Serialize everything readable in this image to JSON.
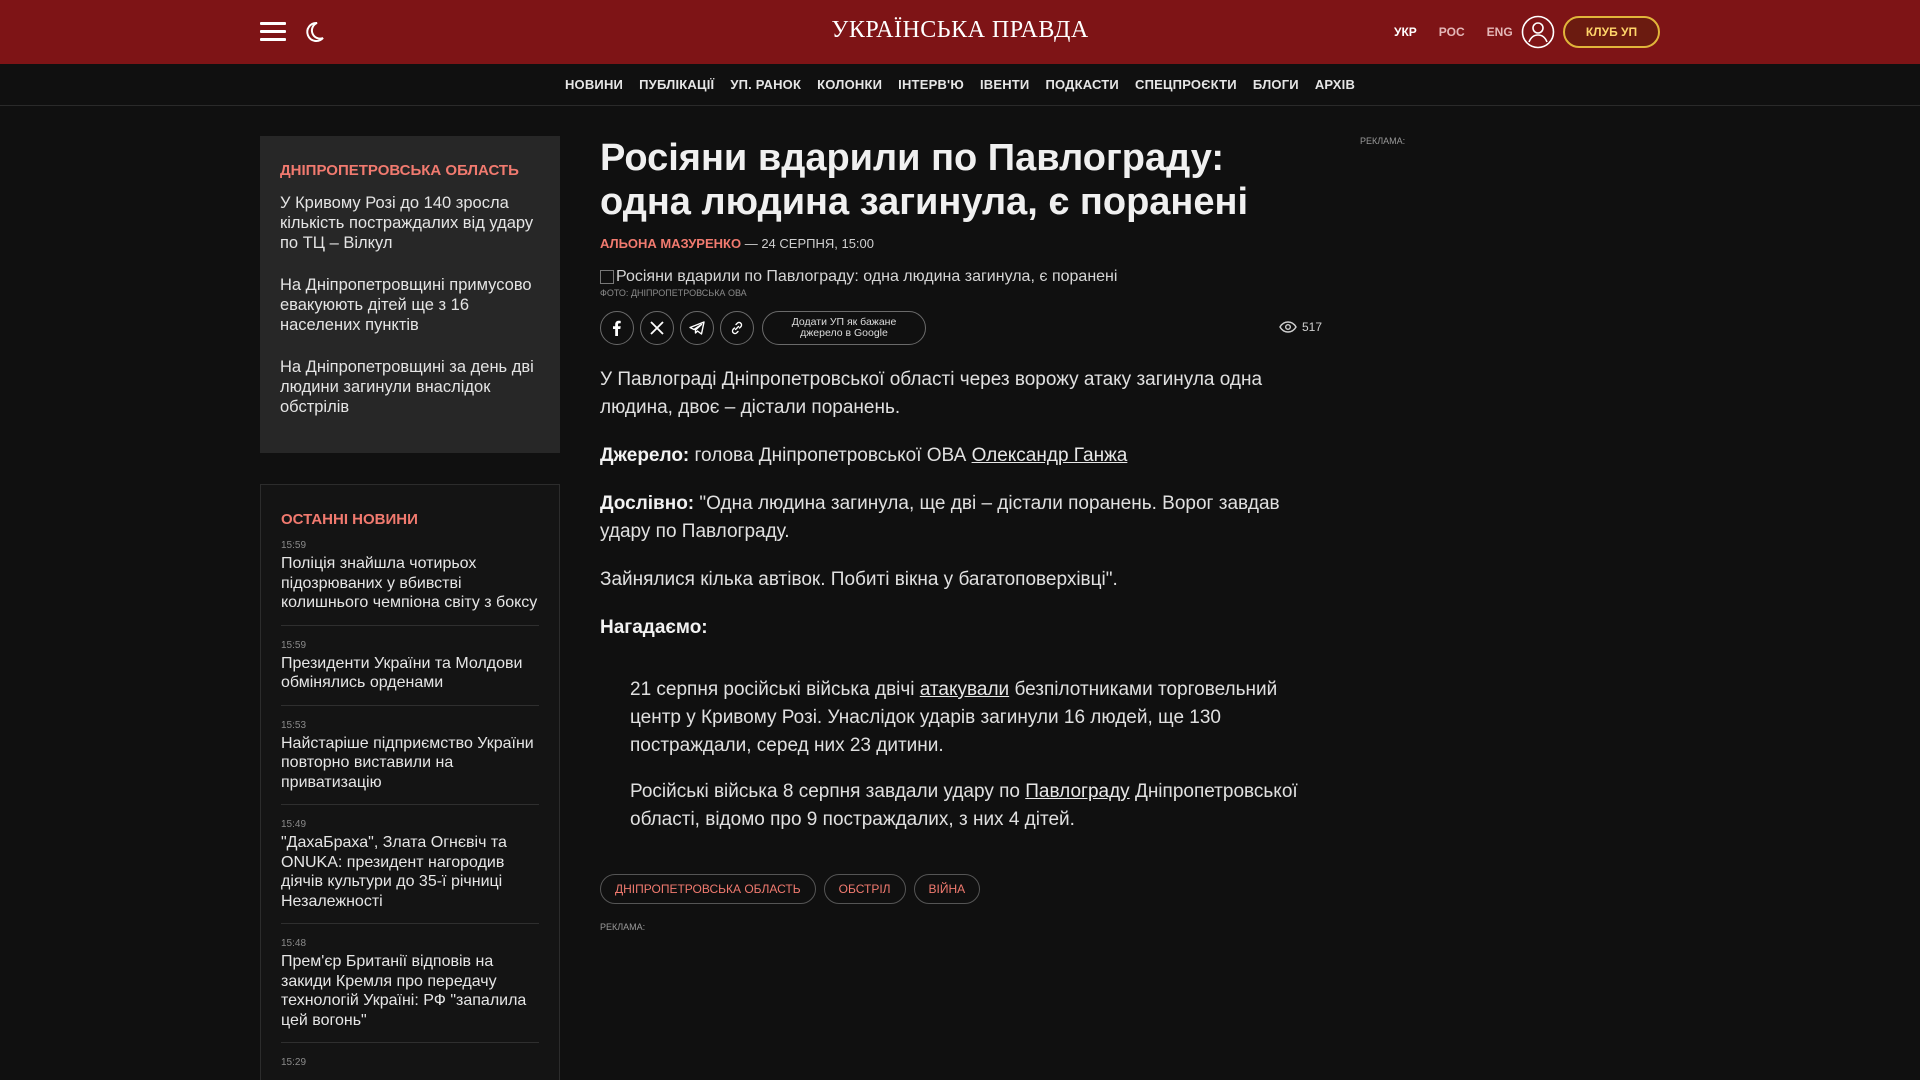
{
  "header": {
    "logo": "УКРАЇНСЬКА ПРАВДА",
    "languages": [
      "УКР",
      "РОС",
      "ENG"
    ],
    "active_language": "УКР",
    "club_button": "КЛУБ УП",
    "brand_color": "#7e1416",
    "accent_color": "#e1b53a"
  },
  "nav": {
    "items": [
      "НОВИНИ",
      "ПУБЛІКАЦІЇ",
      "УП. РАНОК",
      "КОЛОНКИ",
      "ІНТЕРВ'Ю",
      "ІВЕНТИ",
      "ПОДКАСТИ",
      "СПЕЦПРОЄКТИ",
      "БЛОГИ",
      "АРХІВ"
    ]
  },
  "region": {
    "title": "ДНІПРОПЕТРОВСЬКА ОБЛАСТЬ",
    "items": [
      "У Кривому Розі до 140 зросла кількість постраждалих від удару по ТЦ – Вілкул",
      "На Дніпропетровщині примусово евакуюють дітей ще з 16 населених пунктів",
      "На Дніпропетровщині за день дві людини загинули внаслідок обстрілів"
    ]
  },
  "latest": {
    "title": "ОСТАННІ НОВИНИ",
    "items": [
      {
        "time": "15:59",
        "text": "Поліція знайшла чотирьох підозрюваних у вбивстві колишнього чемпіона світу з боксу"
      },
      {
        "time": "15:59",
        "text": "Президенти України та Молдови обмінялись орденами"
      },
      {
        "time": "15:53",
        "text": "Найстаріше підприємство України повторно виставили на приватизацію"
      },
      {
        "time": "15:49",
        "text": "\"ДахаБраха\", Злата Огнєвіч та ONUKA: президент нагородив діячів культури до 35-ї річниці Незалежності"
      },
      {
        "time": "15:48",
        "text": "Прем'єр Британії відповів на закиди Кремля про передачу технологій Україні: РФ \"запалила цей вогонь\""
      },
      {
        "time": "15:29",
        "text": ""
      }
    ]
  },
  "article": {
    "headline": "Росіяни вдарили по Павлограду: одна людина загинула, є поранені",
    "author": "АЛЬОНА МАЗУРЕНКО",
    "date_sep": " — ",
    "date": "24 СЕРПНЯ, 15:00",
    "photo_alt": "Росіяни вдарили по Павлограду: одна людина загинула, є поранені",
    "photo_credit": "ФОТО: ДНІПРОПЕТРОВСЬКА ОВА",
    "google_button": "Додати УП як бажане джерело в Google",
    "views": "517",
    "p1": "У Павлограді Дніпропетровської області через ворожу атаку загинула одна людина, двоє – дістали поранень.",
    "source_label": "Джерело:",
    "source_text": " голова Дніпропетровської ОВА ",
    "source_link": "Олександр Ганжа",
    "quote_label": "Дослівно:",
    "quote_text": " \"Одна людина загинула, ще дві – дістали поранень. Ворог завдав удару по Павлограду.",
    "p_quote2": "Зайнялися кілька автівок. Побиті вікна у багатоповерхівці\".",
    "reminder_label": "Нагадаємо:",
    "r1_a": "21 серпня російські війська двічі ",
    "r1_link": "атакували",
    "r1_b": " безпілотниками торговельний центр у Кривому Розі. Унаслідок ударів загинули 16 людей, ще 130 постраждали, серед них 23 дитини.",
    "r2_a": "Російські війська 8 серпня завдали удару по ",
    "r2_link": "Павлограду",
    "r2_b": " Дніпропетровської області, відомо про 9 постраждалих, з них 4 дітей.",
    "tags": [
      "ДНІПРОПЕТРОВСЬКА ОБЛАСТЬ",
      "ОБСТРІЛ",
      "ВІЙНА"
    ],
    "ad_label": "РЕКЛАМА:"
  },
  "right": {
    "ad_label": "РЕКЛАМА:"
  }
}
